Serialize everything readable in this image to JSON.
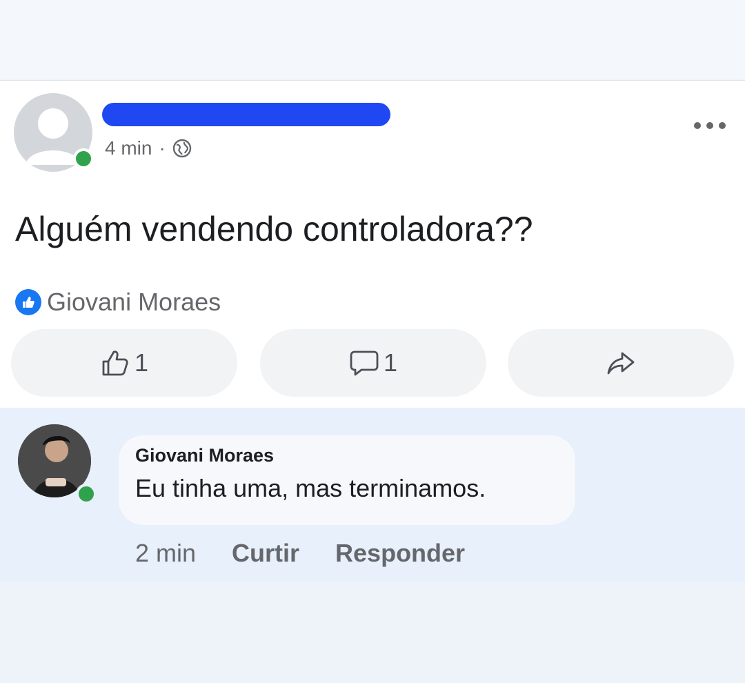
{
  "post": {
    "time": "4 min",
    "separator": "·",
    "text": "Alguém vendendo controladora??",
    "more_icon": "more-options-icon",
    "privacy_icon": "globe-icon",
    "reaction_name": "Giovani Moraes",
    "like_count": "1",
    "comment_count": "1"
  },
  "comment": {
    "author": "Giovani Moraes",
    "text": "Eu tinha uma, mas terminamos.",
    "time": "2 min",
    "like_label": "Curtir",
    "reply_label": "Responder"
  },
  "colors": {
    "accent": "#1877f2",
    "online": "#31a24c",
    "redaction": "#1f48f2"
  }
}
